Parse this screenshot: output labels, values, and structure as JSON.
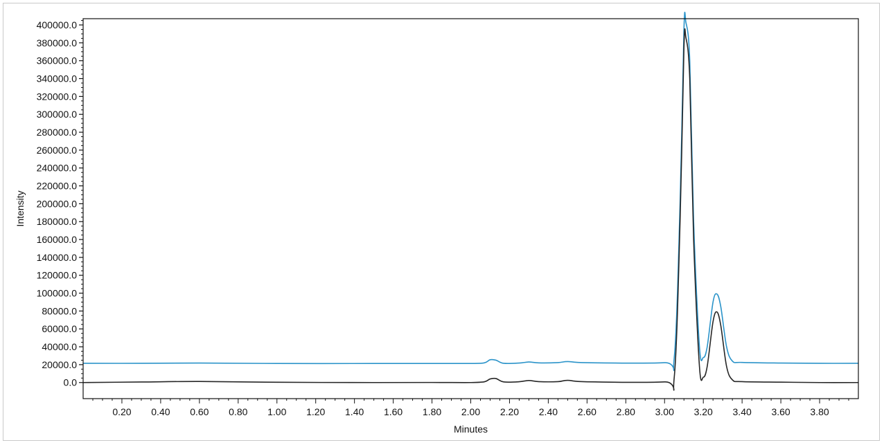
{
  "chart_data": {
    "type": "line",
    "xlabel": "Minutes",
    "ylabel": "Intensity",
    "xlim": [
      0.0,
      4.0
    ],
    "ylim": [
      -18000,
      407000
    ],
    "x_ticks": [
      0.2,
      0.4,
      0.6,
      0.8,
      1.0,
      1.2,
      1.4,
      1.6,
      1.8,
      2.0,
      2.2,
      2.4,
      2.6,
      2.8,
      3.0,
      3.2,
      3.4,
      3.6,
      3.8
    ],
    "x_tick_labels": [
      "0.20",
      "0.40",
      "0.60",
      "0.80",
      "1.00",
      "1.20",
      "1.40",
      "1.60",
      "1.80",
      "2.00",
      "2.20",
      "2.40",
      "2.60",
      "2.80",
      "3.00",
      "3.20",
      "3.40",
      "3.60",
      "3.80"
    ],
    "y_ticks": [
      0,
      20000,
      40000,
      60000,
      80000,
      100000,
      120000,
      140000,
      160000,
      180000,
      200000,
      220000,
      240000,
      260000,
      280000,
      300000,
      320000,
      340000,
      360000,
      380000,
      400000
    ],
    "y_tick_labels": [
      "0.0",
      "20000.0",
      "40000.0",
      "60000.0",
      "80000.0",
      "100000.0",
      "120000.0",
      "140000.0",
      "160000.0",
      "180000.0",
      "200000.0",
      "220000.0",
      "240000.0",
      "260000.0",
      "280000.0",
      "300000.0",
      "320000.0",
      "340000.0",
      "360000.0",
      "380000.0",
      "400000.0"
    ],
    "grid": false,
    "legend": "none",
    "series": [
      {
        "color": "#2a93c9",
        "x": [
          0.0,
          0.3,
          0.6,
          1.0,
          1.5,
          1.8,
          2.0,
          2.07,
          2.1,
          2.13,
          2.17,
          2.25,
          2.3,
          2.35,
          2.45,
          2.5,
          2.6,
          3.0,
          3.05,
          3.08,
          3.1,
          3.11,
          3.13,
          3.15,
          3.18,
          3.2,
          3.22,
          3.25,
          3.27,
          3.29,
          3.32,
          3.35,
          3.4,
          3.6,
          3.8,
          4.0
        ],
        "y": [
          21500,
          21500,
          21800,
          21300,
          21300,
          21300,
          21300,
          22000,
          25500,
          25000,
          21500,
          21800,
          23000,
          22000,
          22300,
          23500,
          22200,
          22200,
          28000,
          200000,
          395000,
          403000,
          360000,
          180000,
          40000,
          28000,
          40000,
          90000,
          99000,
          85000,
          40000,
          24000,
          22500,
          21800,
          21500,
          21500
        ]
      },
      {
        "color": "#262626",
        "x": [
          0.0,
          0.3,
          0.6,
          1.0,
          1.5,
          1.8,
          2.0,
          2.07,
          2.1,
          2.13,
          2.17,
          2.25,
          2.3,
          2.35,
          2.45,
          2.5,
          2.6,
          3.0,
          3.05,
          3.08,
          3.1,
          3.11,
          3.13,
          3.15,
          3.18,
          3.2,
          3.22,
          3.25,
          3.27,
          3.29,
          3.32,
          3.35,
          3.4,
          3.6,
          3.8,
          4.0
        ],
        "y": [
          0,
          600,
          1200,
          300,
          0,
          100,
          0,
          800,
          4000,
          4500,
          700,
          900,
          2300,
          1000,
          1000,
          2500,
          800,
          700,
          6000,
          180000,
          375000,
          386000,
          340000,
          160000,
          18000,
          6000,
          18000,
          68000,
          79000,
          64000,
          18000,
          3000,
          1000,
          400,
          0,
          0
        ]
      }
    ]
  }
}
